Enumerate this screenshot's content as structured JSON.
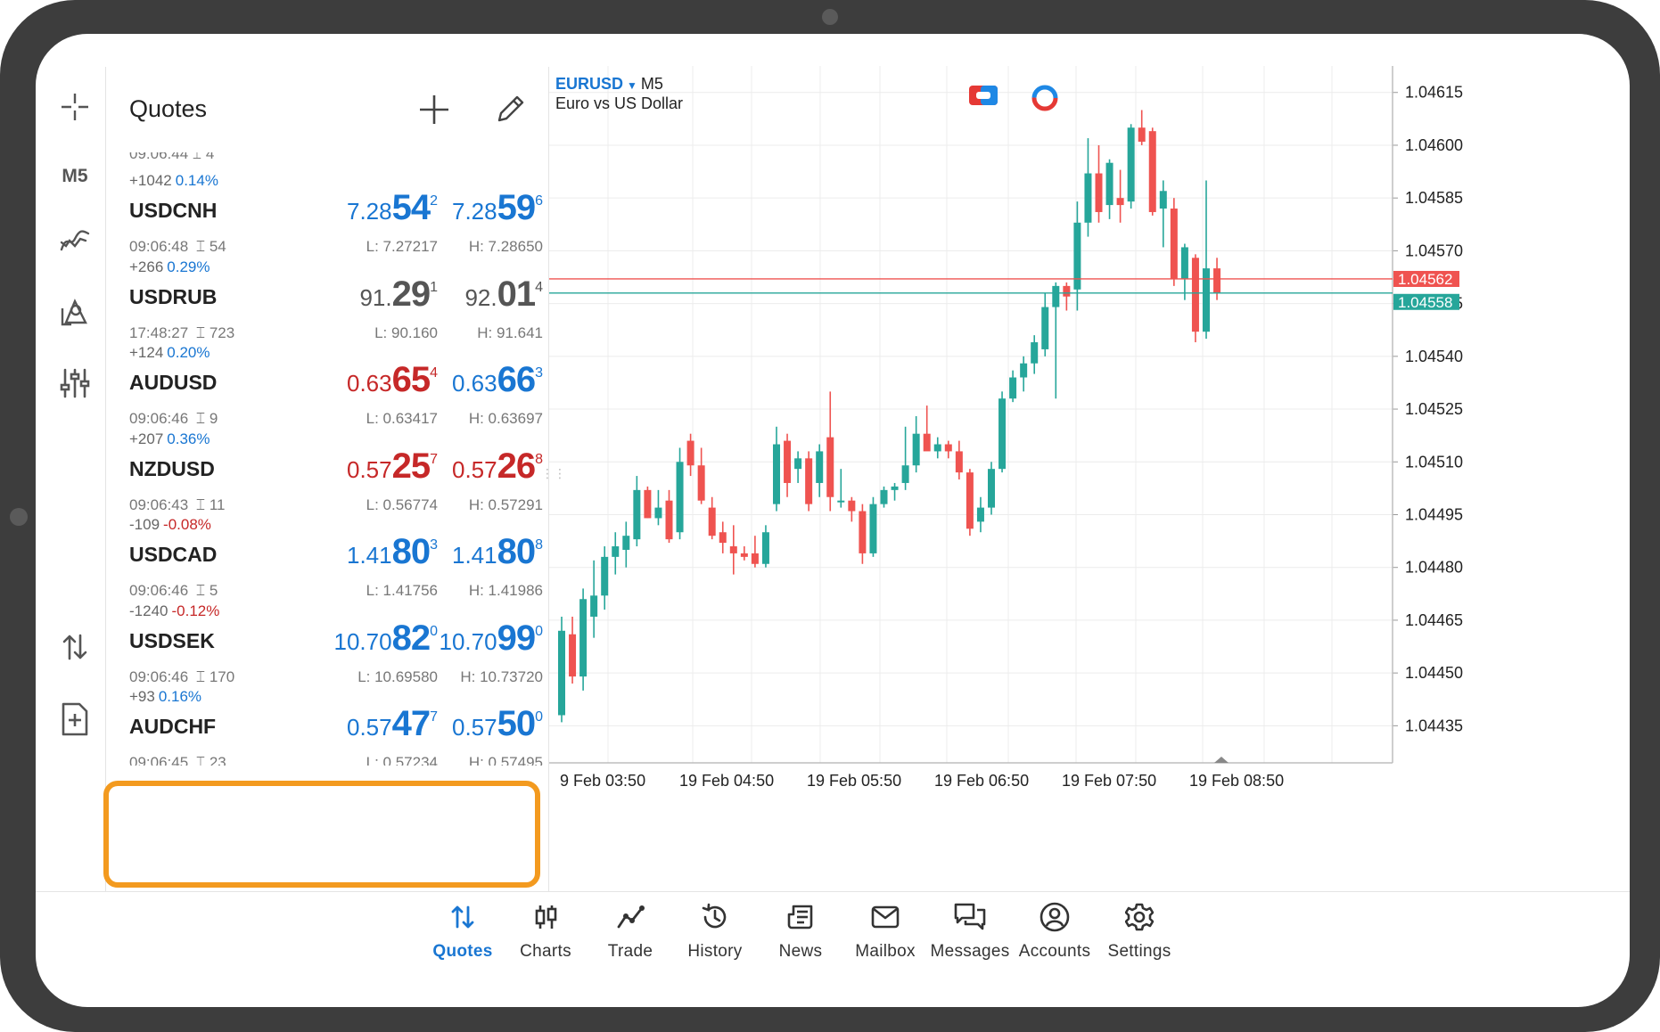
{
  "toolbar": {
    "timeframe": "M5",
    "icons": [
      "crosshair-icon",
      "indicator-icon",
      "objects-icon",
      "settings-sliders-icon",
      "trade-arrows-icon",
      "new-order-icon"
    ]
  },
  "quotes": {
    "title": "Quotes",
    "rows": [
      {
        "change": "+1042",
        "pct": "0.14%",
        "dir": "up",
        "symbol": "USDCNH",
        "time": "09:06:48",
        "spread": "54",
        "bid": {
          "pre": "7.28",
          "big": "54",
          "sup": "2",
          "color": "blue"
        },
        "ask": {
          "pre": "7.28",
          "big": "59",
          "sup": "6",
          "color": "blue"
        },
        "low": "L: 7.27217",
        "high": "H: 7.28650"
      },
      {
        "change": "+266",
        "pct": "0.29%",
        "dir": "up",
        "symbol": "USDRUB",
        "time": "17:48:27",
        "spread": "723",
        "bid": {
          "pre": "91.",
          "big": "29",
          "sup": "1",
          "color": "gray"
        },
        "ask": {
          "pre": "92.",
          "big": "01",
          "sup": "4",
          "color": "gray"
        },
        "low": "L: 90.160",
        "high": "H: 91.641"
      },
      {
        "change": "+124",
        "pct": "0.20%",
        "dir": "up",
        "symbol": "AUDUSD",
        "time": "09:06:46",
        "spread": "9",
        "bid": {
          "pre": "0.63",
          "big": "65",
          "sup": "4",
          "color": "red"
        },
        "ask": {
          "pre": "0.63",
          "big": "66",
          "sup": "3",
          "color": "blue"
        },
        "low": "L: 0.63417",
        "high": "H: 0.63697"
      },
      {
        "change": "+207",
        "pct": "0.36%",
        "dir": "up",
        "symbol": "NZDUSD",
        "time": "09:06:43",
        "spread": "11",
        "bid": {
          "pre": "0.57",
          "big": "25",
          "sup": "7",
          "color": "red"
        },
        "ask": {
          "pre": "0.57",
          "big": "26",
          "sup": "8",
          "color": "red"
        },
        "low": "L: 0.56774",
        "high": "H: 0.57291"
      },
      {
        "change": "-109",
        "pct": "-0.08%",
        "dir": "dn",
        "symbol": "USDCAD",
        "time": "09:06:46",
        "spread": "5",
        "bid": {
          "pre": "1.41",
          "big": "80",
          "sup": "3",
          "color": "blue"
        },
        "ask": {
          "pre": "1.41",
          "big": "80",
          "sup": "8",
          "color": "blue"
        },
        "low": "L: 1.41756",
        "high": "H: 1.41986"
      },
      {
        "change": "-1240",
        "pct": "-0.12%",
        "dir": "dn",
        "symbol": "USDSEK",
        "time": "09:06:46",
        "spread": "170",
        "bid": {
          "pre": "10.70",
          "big": "82",
          "sup": "0",
          "color": "blue"
        },
        "ask": {
          "pre": "10.70",
          "big": "99",
          "sup": "0",
          "color": "blue"
        },
        "low": "L: 10.69580",
        "high": "H: 10.73720"
      },
      {
        "change": "+93",
        "pct": "0.16%",
        "dir": "up",
        "symbol": "AUDCHF",
        "time": "09:06:45",
        "spread": "23",
        "bid": {
          "pre": "0.57",
          "big": "47",
          "sup": "7",
          "color": "blue"
        },
        "ask": {
          "pre": "0.57",
          "big": "50",
          "sup": "0",
          "color": "blue"
        },
        "low": "L: 0.57234",
        "high": "H: 0.57495"
      }
    ]
  },
  "chart": {
    "symbol": "EURUSD",
    "timeframe": "M5",
    "description": "Euro vs US Dollar",
    "colors": {
      "up": "#26a69a",
      "down": "#ef5350",
      "ask_line": "#ef5350",
      "bid_line": "#26a69a"
    }
  },
  "chart_data": {
    "type": "candlestick",
    "y_ticks": [
      1.04435,
      1.0445,
      1.04465,
      1.0448,
      1.04495,
      1.0451,
      1.04525,
      1.0454,
      1.04555,
      1.0457,
      1.04585,
      1.046,
      1.04615
    ],
    "ylim": [
      1.04428,
      1.0462
    ],
    "x_ticks": [
      "9 Feb 03:50",
      "19 Feb 04:50",
      "19 Feb 05:50",
      "19 Feb 06:50",
      "19 Feb 07:50",
      "19 Feb 08:50"
    ],
    "ask_price": "1.04562",
    "bid_price": "1.04558",
    "candles": [
      {
        "o": 1.04438,
        "h": 1.04466,
        "l": 1.04436,
        "c": 1.04462
      },
      {
        "o": 1.04461,
        "h": 1.04466,
        "l": 1.04447,
        "c": 1.04449
      },
      {
        "o": 1.04449,
        "h": 1.04474,
        "l": 1.04445,
        "c": 1.04471
      },
      {
        "o": 1.04466,
        "h": 1.04482,
        "l": 1.0446,
        "c": 1.04472
      },
      {
        "o": 1.04472,
        "h": 1.04486,
        "l": 1.04468,
        "c": 1.04483
      },
      {
        "o": 1.04483,
        "h": 1.0449,
        "l": 1.04478,
        "c": 1.04486
      },
      {
        "o": 1.04485,
        "h": 1.04493,
        "l": 1.0448,
        "c": 1.04489
      },
      {
        "o": 1.04488,
        "h": 1.04506,
        "l": 1.04486,
        "c": 1.04502
      },
      {
        "o": 1.04502,
        "h": 1.04503,
        "l": 1.04494,
        "c": 1.04494
      },
      {
        "o": 1.04494,
        "h": 1.04502,
        "l": 1.04492,
        "c": 1.04497
      },
      {
        "o": 1.04499,
        "h": 1.04502,
        "l": 1.04487,
        "c": 1.04488
      },
      {
        "o": 1.0449,
        "h": 1.04514,
        "l": 1.04488,
        "c": 1.0451
      },
      {
        "o": 1.04516,
        "h": 1.04518,
        "l": 1.04506,
        "c": 1.04509
      },
      {
        "o": 1.04509,
        "h": 1.04514,
        "l": 1.04498,
        "c": 1.04499
      },
      {
        "o": 1.04497,
        "h": 1.045,
        "l": 1.04488,
        "c": 1.04489
      },
      {
        "o": 1.0449,
        "h": 1.04493,
        "l": 1.04484,
        "c": 1.04487
      },
      {
        "o": 1.04486,
        "h": 1.04492,
        "l": 1.04478,
        "c": 1.04484
      },
      {
        "o": 1.04484,
        "h": 1.04486,
        "l": 1.04482,
        "c": 1.04483
      },
      {
        "o": 1.04484,
        "h": 1.04489,
        "l": 1.0448,
        "c": 1.04481
      },
      {
        "o": 1.04481,
        "h": 1.04492,
        "l": 1.0448,
        "c": 1.0449
      },
      {
        "o": 1.04498,
        "h": 1.0452,
        "l": 1.04496,
        "c": 1.04515
      },
      {
        "o": 1.04516,
        "h": 1.04518,
        "l": 1.045,
        "c": 1.04504
      },
      {
        "o": 1.04508,
        "h": 1.04513,
        "l": 1.04504,
        "c": 1.04511
      },
      {
        "o": 1.04511,
        "h": 1.04513,
        "l": 1.04496,
        "c": 1.04498
      },
      {
        "o": 1.04504,
        "h": 1.04515,
        "l": 1.045,
        "c": 1.04513
      },
      {
        "o": 1.04517,
        "h": 1.0453,
        "l": 1.04496,
        "c": 1.045
      },
      {
        "o": 1.04499,
        "h": 1.04508,
        "l": 1.04497,
        "c": 1.04499
      },
      {
        "o": 1.04499,
        "h": 1.045,
        "l": 1.04493,
        "c": 1.04496
      },
      {
        "o": 1.04496,
        "h": 1.04498,
        "l": 1.04481,
        "c": 1.04484
      },
      {
        "o": 1.04484,
        "h": 1.045,
        "l": 1.04483,
        "c": 1.04498
      },
      {
        "o": 1.04498,
        "h": 1.04503,
        "l": 1.04497,
        "c": 1.04502
      },
      {
        "o": 1.04502,
        "h": 1.04504,
        "l": 1.04499,
        "c": 1.04503
      },
      {
        "o": 1.04504,
        "h": 1.0452,
        "l": 1.04502,
        "c": 1.04509
      },
      {
        "o": 1.04509,
        "h": 1.04523,
        "l": 1.04507,
        "c": 1.04518
      },
      {
        "o": 1.04518,
        "h": 1.04526,
        "l": 1.04514,
        "c": 1.04513
      },
      {
        "o": 1.04513,
        "h": 1.04517,
        "l": 1.04511,
        "c": 1.04515
      },
      {
        "o": 1.04515,
        "h": 1.04516,
        "l": 1.04511,
        "c": 1.04513
      },
      {
        "o": 1.04513,
        "h": 1.04516,
        "l": 1.04505,
        "c": 1.04507
      },
      {
        "o": 1.04507,
        "h": 1.04508,
        "l": 1.04489,
        "c": 1.04491
      },
      {
        "o": 1.04493,
        "h": 1.045,
        "l": 1.0449,
        "c": 1.04497
      },
      {
        "o": 1.04497,
        "h": 1.0451,
        "l": 1.04495,
        "c": 1.04508
      },
      {
        "o": 1.04508,
        "h": 1.0453,
        "l": 1.04507,
        "c": 1.04528
      },
      {
        "o": 1.04528,
        "h": 1.04536,
        "l": 1.04527,
        "c": 1.04534
      },
      {
        "o": 1.04534,
        "h": 1.0454,
        "l": 1.0453,
        "c": 1.04538
      },
      {
        "o": 1.04538,
        "h": 1.04546,
        "l": 1.04535,
        "c": 1.04544
      },
      {
        "o": 1.04542,
        "h": 1.04558,
        "l": 1.0454,
        "c": 1.04554
      },
      {
        "o": 1.04554,
        "h": 1.04561,
        "l": 1.04528,
        "c": 1.0456
      },
      {
        "o": 1.0456,
        "h": 1.04561,
        "l": 1.04553,
        "c": 1.04557
      },
      {
        "o": 1.04559,
        "h": 1.04584,
        "l": 1.04553,
        "c": 1.04578
      },
      {
        "o": 1.04578,
        "h": 1.04602,
        "l": 1.04574,
        "c": 1.04592
      },
      {
        "o": 1.04592,
        "h": 1.046,
        "l": 1.04578,
        "c": 1.04581
      },
      {
        "o": 1.04583,
        "h": 1.04596,
        "l": 1.04579,
        "c": 1.04595
      },
      {
        "o": 1.04585,
        "h": 1.04593,
        "l": 1.04578,
        "c": 1.04583
      },
      {
        "o": 1.04584,
        "h": 1.04606,
        "l": 1.04582,
        "c": 1.04605
      },
      {
        "o": 1.04605,
        "h": 1.0461,
        "l": 1.046,
        "c": 1.04601
      },
      {
        "o": 1.04604,
        "h": 1.04605,
        "l": 1.0458,
        "c": 1.04581
      },
      {
        "o": 1.04582,
        "h": 1.0459,
        "l": 1.04571,
        "c": 1.04587
      },
      {
        "o": 1.04582,
        "h": 1.04585,
        "l": 1.0456,
        "c": 1.04562
      },
      {
        "o": 1.04562,
        "h": 1.04572,
        "l": 1.04556,
        "c": 1.04571
      },
      {
        "o": 1.04568,
        "h": 1.04569,
        "l": 1.04544,
        "c": 1.04547
      },
      {
        "o": 1.04547,
        "h": 1.0459,
        "l": 1.04545,
        "c": 1.04565
      },
      {
        "o": 1.04565,
        "h": 1.04568,
        "l": 1.04556,
        "c": 1.04558
      }
    ]
  },
  "nav": {
    "items": [
      {
        "label": "Quotes",
        "icon": "quotes-arrows-icon",
        "active": true
      },
      {
        "label": "Charts",
        "icon": "candles-icon",
        "active": false
      },
      {
        "label": "Trade",
        "icon": "trade-line-icon",
        "active": false
      },
      {
        "label": "History",
        "icon": "history-clock-icon",
        "active": false
      },
      {
        "label": "News",
        "icon": "news-icon",
        "active": false
      },
      {
        "label": "Mailbox",
        "icon": "mail-icon",
        "active": false
      },
      {
        "label": "Messages",
        "icon": "chat-icon",
        "active": false
      },
      {
        "label": "Accounts",
        "icon": "account-icon",
        "active": false
      },
      {
        "label": "Settings",
        "icon": "gear-icon",
        "active": false
      }
    ]
  }
}
